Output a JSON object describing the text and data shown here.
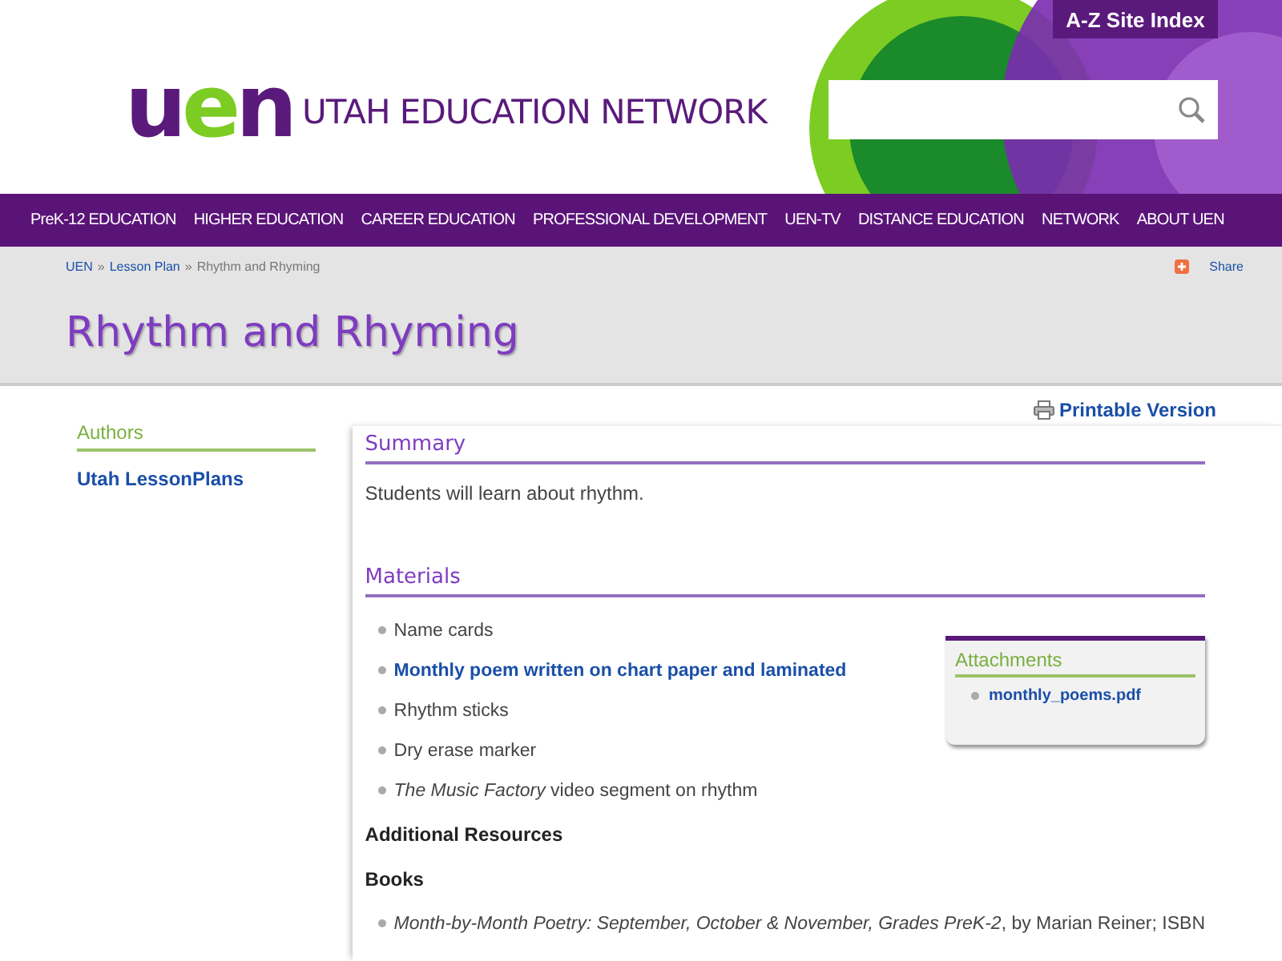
{
  "header": {
    "logo": "uen",
    "site_name": "UTAH EDUCATION NETWORK",
    "site_index": "A-Z Site Index"
  },
  "nav": [
    "PreK-12 EDUCATION",
    "HIGHER EDUCATION",
    "CAREER EDUCATION",
    "PROFESSIONAL DEVELOPMENT",
    "UEN-TV",
    "DISTANCE EDUCATION",
    "NETWORK",
    "ABOUT UEN"
  ],
  "breadcrumb": [
    {
      "label": "UEN",
      "kind": "link"
    },
    {
      "label": "»",
      "kind": "sep"
    },
    {
      "label": "Lesson Plan",
      "kind": "link"
    },
    {
      "label": "»",
      "kind": "sep"
    },
    {
      "label": "Rhythm and Rhyming",
      "kind": "current"
    }
  ],
  "share": "Share",
  "title": "Rhythm and Rhyming",
  "sidebar": {
    "heading": "Authors",
    "items": [
      "Utah LessonPlans"
    ]
  },
  "printable": "Printable Version",
  "summary": {
    "heading": "Summary",
    "text": "Students will learn about rhythm."
  },
  "materials": {
    "heading": "Materials",
    "items": [
      {
        "text": "Name cards",
        "kind": "plain"
      },
      {
        "text": "Monthly poem written on chart paper and laminated",
        "kind": "link"
      },
      {
        "text": "Rhythm sticks",
        "kind": "plain"
      },
      {
        "text": "Dry erase marker",
        "kind": "plain"
      },
      {
        "text": "*The Music Factory* video segment on rhythm",
        "kind": "plain"
      }
    ]
  },
  "attachments": {
    "heading": "Attachments",
    "items": [
      "monthly_poems.pdf"
    ]
  },
  "additional_heading": "Additional Resources",
  "books": {
    "heading": "Books",
    "items": [
      {
        "text": "*Month-by-Month Poetry: September, October & November, Grades PreK-2*, by Marian Reiner; ISBN"
      }
    ]
  }
}
